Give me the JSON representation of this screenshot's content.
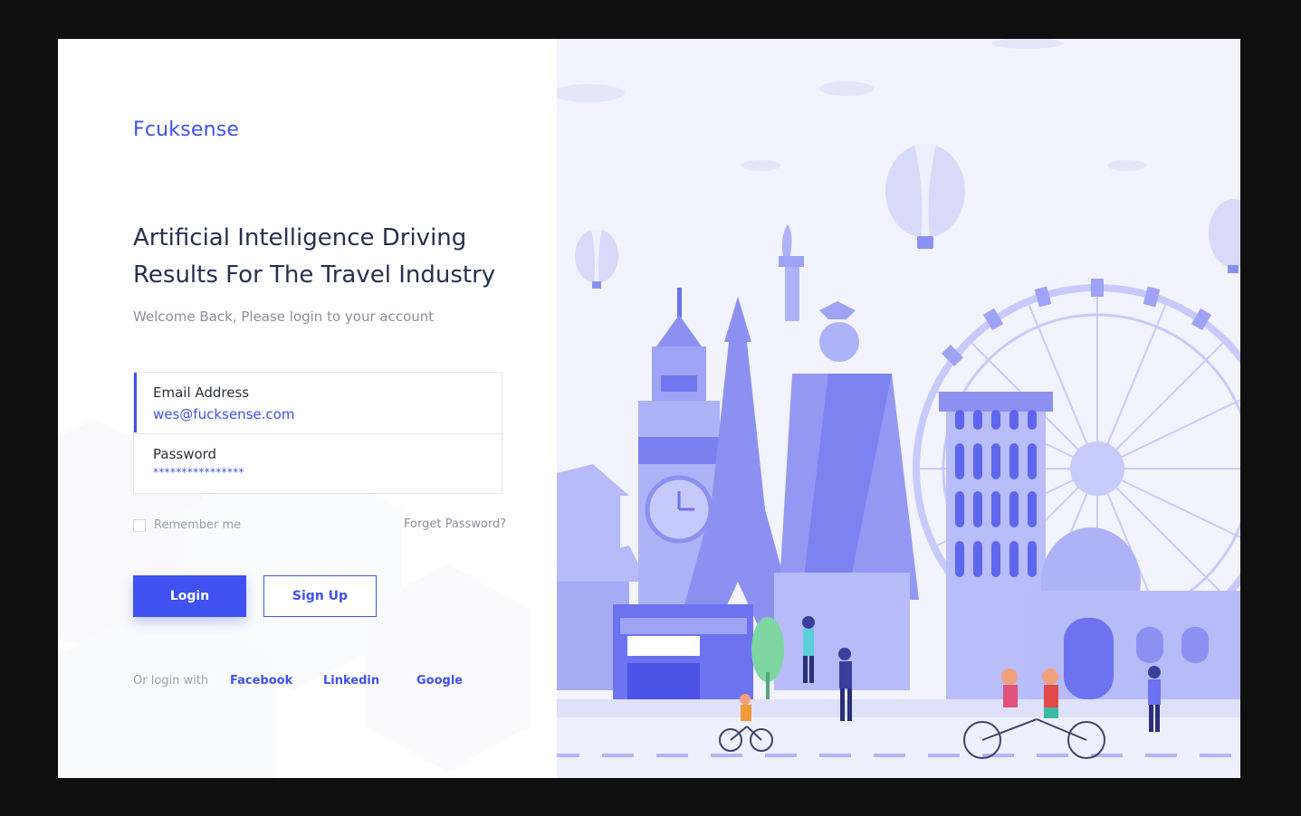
{
  "brand": {
    "name": "Fcuksense"
  },
  "hero": {
    "headline": "Artificial Intelligence Driving\nResults For The Travel Industry",
    "subtitle": "Welcome Back, Please login to your account"
  },
  "form": {
    "email": {
      "label": "Email Address",
      "value": "wes@fucksense.com"
    },
    "password": {
      "label": "Password",
      "value": "****************"
    },
    "remember_label": "Remember me",
    "remember_checked": false,
    "forgot_label": "Forget Password?"
  },
  "actions": {
    "login_label": "Login",
    "signup_label": "Sign Up"
  },
  "social": {
    "label": "Or login with",
    "providers": [
      "Facebook",
      "Linkedin",
      "Google"
    ]
  },
  "illustration": {
    "description_icon": "travel-landmarks-illustration"
  },
  "colors": {
    "accent": "#3f51f0",
    "heading": "#26304f",
    "muted": "#8a8f9c",
    "illustration_bg": "#f2f3fd",
    "illustration_primary": "#6c72f0"
  }
}
